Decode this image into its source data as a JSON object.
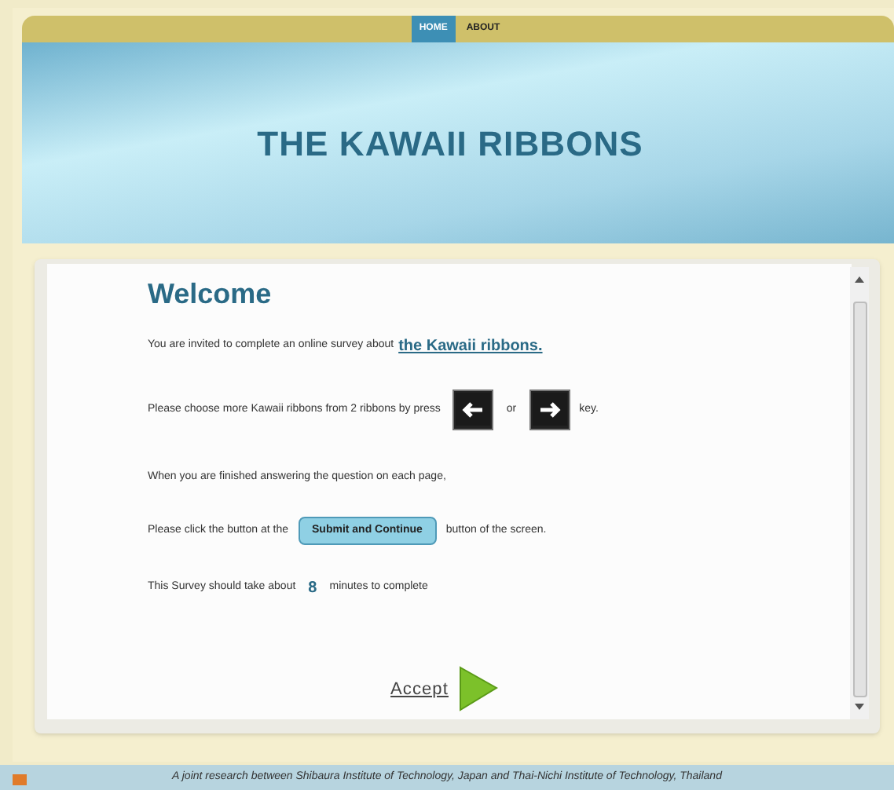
{
  "nav": {
    "tabs": [
      {
        "label": "HOME",
        "selected": true
      },
      {
        "label": "ABOUT",
        "selected": false
      }
    ]
  },
  "banner": {
    "title": "THE KAWAII RIBBONS"
  },
  "content": {
    "heading": "Welcome",
    "lines": [
      {
        "kind": "link",
        "text": "You are invited to complete an online survey about",
        "link": "the Kawaii ribbons."
      },
      {
        "kind": "keys",
        "text": "Please choose more Kawaii ribbons from 2 ribbons by press",
        "between": "or",
        "after": "key."
      },
      {
        "kind": "plain",
        "text": "When you are finished answering the question on each page,"
      },
      {
        "kind": "button",
        "text": "Please click the button at the",
        "button": "Submit and Continue",
        "after": "button of the screen."
      },
      {
        "kind": "number",
        "text": "This Survey should take about",
        "number": "8",
        "after": "minutes to complete"
      }
    ],
    "accept": "Accept"
  },
  "footer": "A joint research between Shibaura Institute of Technology, Japan and Thai-Nichi Institute of Technology, Thailand"
}
